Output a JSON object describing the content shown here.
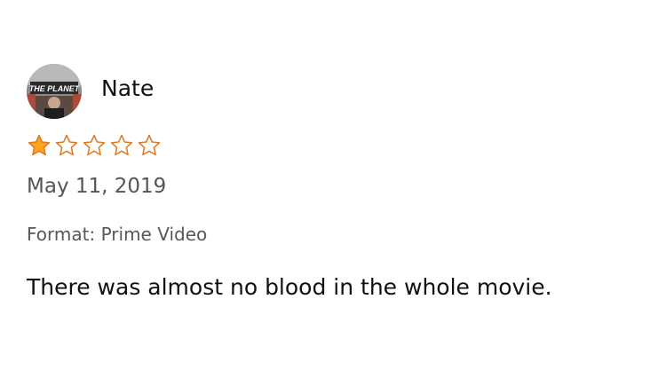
{
  "reviewer": {
    "name": "Nate",
    "avatar_text": "THE PLANET"
  },
  "rating": {
    "value": 1,
    "max": 5,
    "star_color": "#ffa41c",
    "star_outline": "#de7921"
  },
  "review": {
    "date": "May 11, 2019",
    "format": "Format: Prime Video",
    "body": "There was almost no blood in the whole movie."
  }
}
